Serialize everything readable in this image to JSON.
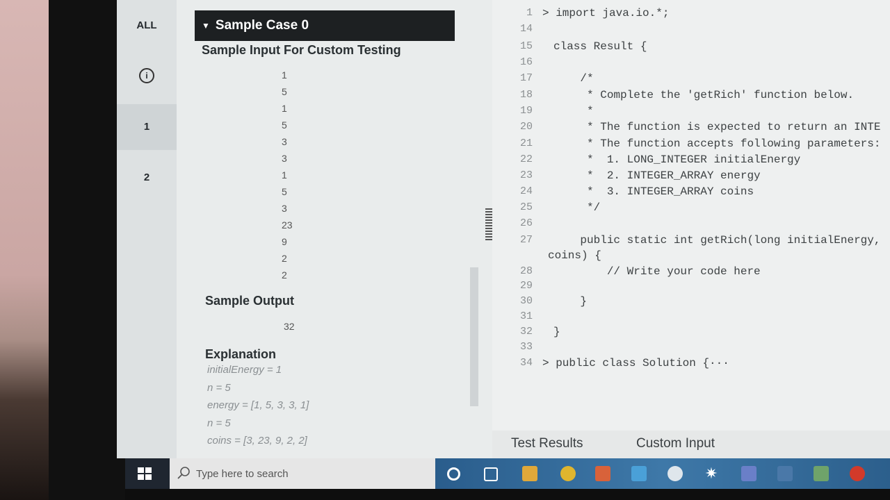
{
  "sidebar": {
    "items": [
      {
        "label": "ALL"
      },
      {
        "label": "i"
      },
      {
        "label": "1"
      },
      {
        "label": "2"
      }
    ]
  },
  "panel": {
    "case_title": "Sample Case 0",
    "input_title": "Sample Input For Custom Testing",
    "input_values": [
      "1",
      "5",
      "1",
      "5",
      "3",
      "3",
      "1",
      "5",
      "3",
      "23",
      "9",
      "2",
      "2"
    ],
    "output_title": "Sample Output",
    "output_value": "32",
    "explanation_title": "Explanation",
    "explanation_lines": [
      "initialEnergy = 1",
      "n = 5",
      "energy = [1, 5, 3, 3, 1]",
      "n = 5",
      "coins = [3, 23, 9, 2, 2]"
    ]
  },
  "editor": {
    "lines": [
      {
        "n": "1",
        "text": "> import java.io.*;"
      },
      {
        "n": "14",
        "text": ""
      },
      {
        "n": "15",
        "text": "class Result {"
      },
      {
        "n": "16",
        "text": ""
      },
      {
        "n": "17",
        "text": "    /*"
      },
      {
        "n": "18",
        "text": "     * Complete the 'getRich' function below."
      },
      {
        "n": "19",
        "text": "     *"
      },
      {
        "n": "20",
        "text": "     * The function is expected to return an INTE"
      },
      {
        "n": "21",
        "text": "     * The function accepts following parameters:"
      },
      {
        "n": "22",
        "text": "     *  1. LONG_INTEGER initialEnergy"
      },
      {
        "n": "23",
        "text": "     *  2. INTEGER_ARRAY energy"
      },
      {
        "n": "24",
        "text": "     *  3. INTEGER_ARRAY coins"
      },
      {
        "n": "25",
        "text": "     */"
      },
      {
        "n": "26",
        "text": ""
      },
      {
        "n": "27",
        "text": "    public static int getRich(long initialEnergy,"
      },
      {
        "n": "",
        "text": "coins) {"
      },
      {
        "n": "28",
        "text": "        // Write your code here"
      },
      {
        "n": "29",
        "text": ""
      },
      {
        "n": "30",
        "text": "    }"
      },
      {
        "n": "31",
        "text": ""
      },
      {
        "n": "32",
        "text": "}"
      },
      {
        "n": "33",
        "text": ""
      },
      {
        "n": "34",
        "text": "> public class Solution {···"
      }
    ],
    "tabs": [
      "Test Results",
      "Custom Input"
    ]
  },
  "taskbar": {
    "search_placeholder": "Type here to search"
  }
}
